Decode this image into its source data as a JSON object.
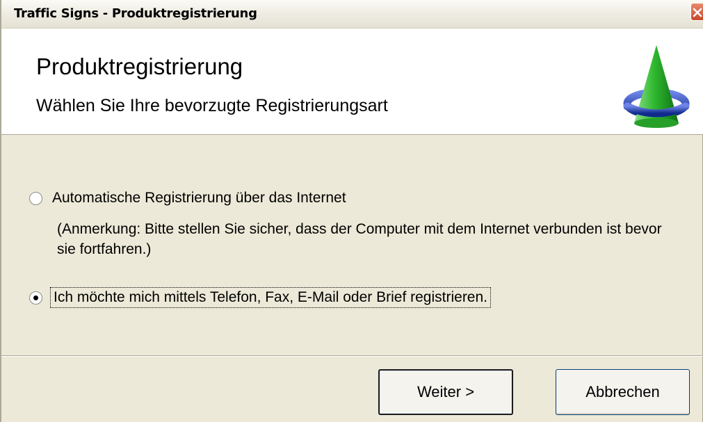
{
  "window": {
    "title": "Traffic Signs - Produktregistrierung",
    "close_icon": "close-icon"
  },
  "header": {
    "title": "Produktregistrierung",
    "subtitle": "Wählen Sie Ihre bevorzugte Registrierungsart",
    "logo_icon": "green-cone-with-blue-ring-icon"
  },
  "options": [
    {
      "label": "Automatische Registrierung über das Internet",
      "checked": false
    },
    {
      "label": "Ich möchte mich mittels Telefon, Fax, E-Mail oder Brief registrieren.",
      "checked": true
    }
  ],
  "note": "(Anmerkung: Bitte stellen Sie sicher, dass der Computer mit dem Internet verbunden ist bevor sie fortfahren.)",
  "buttons": {
    "next_label": "Weiter >",
    "cancel_label": "Abbrechen"
  },
  "colors": {
    "dialog_background": "#ece9d8",
    "header_background": "#ffffff",
    "close_button": "#c8472b",
    "logo_cone": "#2fb82f",
    "logo_ring": "#1f3fc0"
  }
}
